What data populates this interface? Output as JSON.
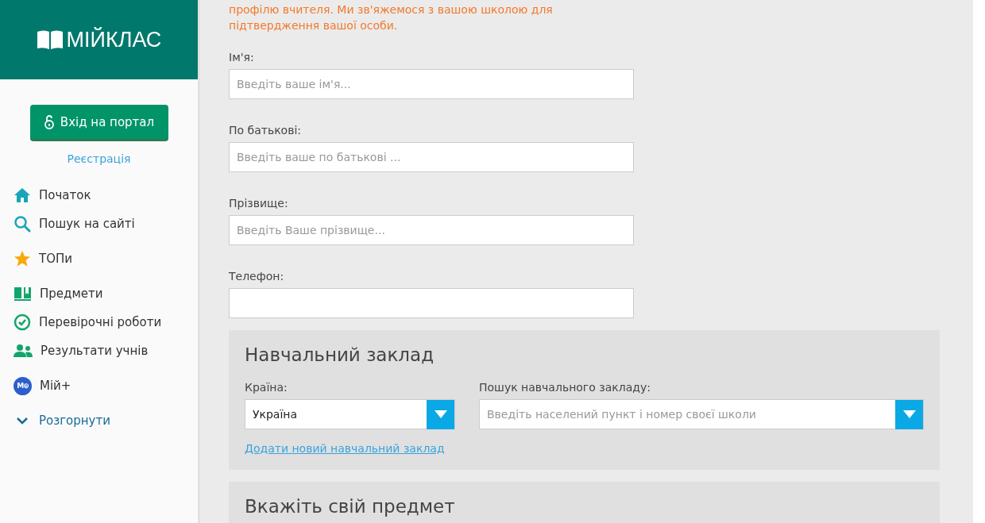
{
  "logo": {
    "text": "МІЙКЛАС"
  },
  "login_button": {
    "label": "Вхід на портал"
  },
  "register_link": {
    "label": "Реєстрація"
  },
  "nav_groups": [
    [
      {
        "kind": "home",
        "label": "Початок"
      },
      {
        "kind": "search",
        "label": "Пошук на сайті"
      }
    ],
    [
      {
        "kind": "star",
        "label": "ТОПи"
      }
    ],
    [
      {
        "kind": "books",
        "label": "Предмети"
      },
      {
        "kind": "check",
        "label": "Перевірочні роботи"
      },
      {
        "kind": "people",
        "label": "Результати учнів"
      }
    ],
    [
      {
        "kind": "badge",
        "label": "Мій+",
        "badge_text": "M⊕"
      }
    ],
    [
      {
        "kind": "chevron",
        "label": "Розгорнути"
      }
    ]
  ],
  "notice": "профілю вчителя. Ми зв'яжемося з вашою школою для підтвердження вашої особи.",
  "fields": [
    {
      "label": "Ім'я:",
      "placeholder": "Введіть ваше ім'я..."
    },
    {
      "label": "По батькові:",
      "placeholder": "Введіть ваше по батькові ..."
    },
    {
      "label": "Прізвище:",
      "placeholder": "Введіть Ваше прізвище..."
    },
    {
      "label": "Телефон:"
    }
  ],
  "school_panel": {
    "title": "Навчальний заклад",
    "country": {
      "label": "Країна:",
      "value": "Україна"
    },
    "school_search": {
      "label": "Пошук навчального закладу:",
      "placeholder": "Введіть населений пункт і номер своєї школи"
    },
    "add_link": "Додати новий навчальний заклад"
  },
  "subject_panel": {
    "title": "Вкажіть свій предмет"
  }
}
